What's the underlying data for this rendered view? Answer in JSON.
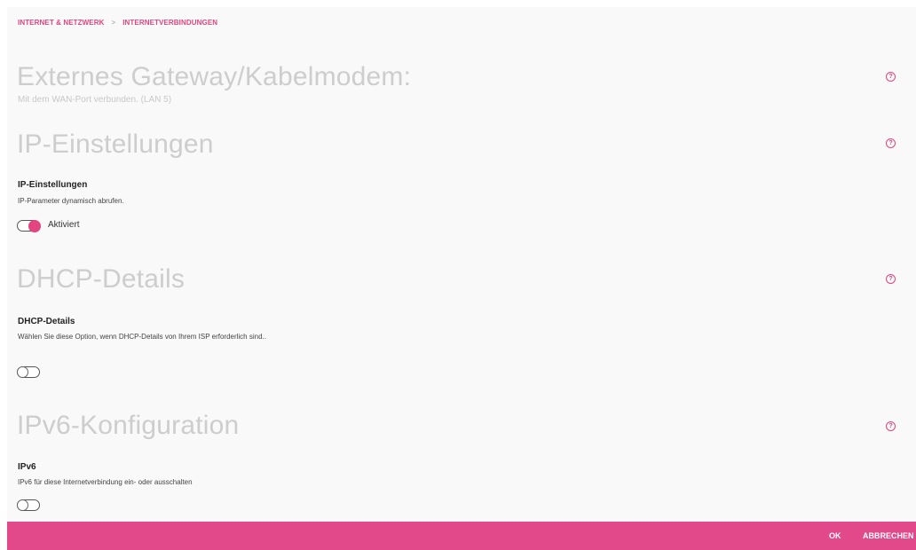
{
  "breadcrumb": {
    "item1": "INTERNET & NETZWERK",
    "sep": ">",
    "item2": "INTERNETVERBINDUNGEN"
  },
  "help_glyph": "?",
  "accent_color": "#e2457f",
  "sections": {
    "gateway": {
      "title": "Externes Gateway/Kabelmodem:",
      "subtitle": "Mit dem WAN-Port verbunden. (LAN 5)"
    },
    "ip": {
      "title": "IP-Einstellungen",
      "label": "IP-Einstellungen",
      "desc": "IP-Parameter dynamisch abrufen.",
      "toggle_state": "on",
      "toggle_text": "Aktiviert"
    },
    "dhcp": {
      "title": "DHCP-Details",
      "label": "DHCP-Details",
      "desc": "Wählen Sie diese Option, wenn DHCP-Details von Ihrem ISP erforderlich sind..",
      "toggle_state": "off"
    },
    "ipv6": {
      "title": "IPv6-Konfiguration",
      "label": "IPv6",
      "desc": "IPv6 für diese Internetverbindung ein- oder ausschalten",
      "toggle_state": "off"
    }
  },
  "footer": {
    "ok": "OK",
    "cancel": "ABBRECHEN"
  }
}
